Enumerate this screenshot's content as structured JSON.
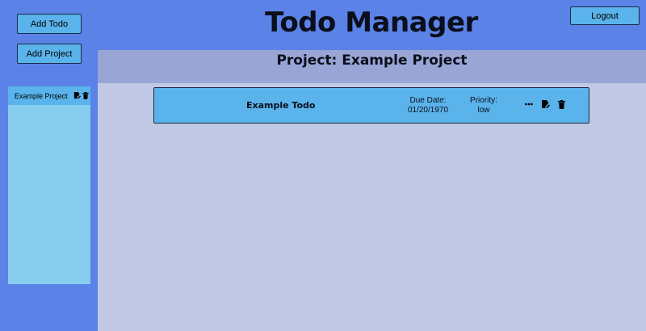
{
  "header": {
    "title": "Todo Manager",
    "logout_label": "Logout"
  },
  "sidebar": {
    "add_todo_label": "Add Todo",
    "add_project_label": "Add Project",
    "projects": [
      {
        "name": "Example Project",
        "icons": [
          "edit-icon",
          "trash-icon"
        ]
      }
    ]
  },
  "main": {
    "project_heading": "Project: Example Project",
    "todos": [
      {
        "title": "Example Todo",
        "due_label": "Due Date:",
        "due_value": "01/20/1970",
        "priority_label": "Priority:",
        "priority_value": "low",
        "icons": [
          "more-dots-icon",
          "edit-icon",
          "trash-icon"
        ]
      }
    ]
  },
  "colors": {
    "page_background": "#5b82e6",
    "button_fill": "#5ab3ea",
    "sidebar_panel": "#87cdee",
    "main_background": "#c1c8e4",
    "project_header": "#98a5d5",
    "text_dark": "#0b0f1c"
  }
}
